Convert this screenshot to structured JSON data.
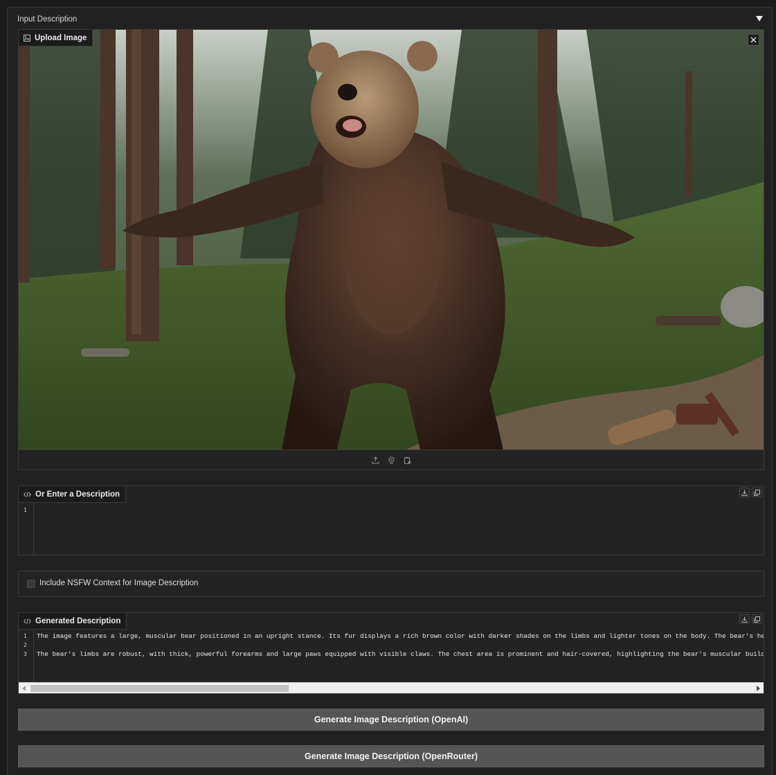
{
  "accordion": {
    "title": "Input Description"
  },
  "image_upload": {
    "label": "Upload Image",
    "image_subject": "Brown bear standing upright with arms outstretched in a pine forest clearing"
  },
  "description_input": {
    "label": "Or Enter a Description",
    "line_numbers": [
      "1"
    ],
    "value": ""
  },
  "nsfw": {
    "label": "Include NSFW Context for Image Description",
    "checked": false
  },
  "generated": {
    "label": "Generated Description",
    "line_numbers": [
      "1",
      "2",
      "3"
    ],
    "lines": [
      "The image features a large, muscular bear positioned in an upright stance. Its fur displays a rich brown color with darker shades on the limbs and lighter tones on the body. The bear's head is ro",
      "",
      "The bear's limbs are robust, with thick, powerful forearms and large paws equipped with visible claws. The chest area is prominent and hair-covered, highlighting the bear's muscular build. The ba"
    ]
  },
  "buttons": {
    "openai": "Generate Image Description (OpenAI)",
    "openrouter": "Generate Image Description (OpenRouter)"
  },
  "icons": {
    "toggle": "triangle-down-icon",
    "image_label": "image-icon",
    "code_label": "code-icon",
    "close": "close-icon",
    "upload": "upload-icon",
    "webcam": "webcam-icon",
    "clipboard": "clipboard-icon",
    "download": "download-icon",
    "copy": "copy-icon"
  }
}
